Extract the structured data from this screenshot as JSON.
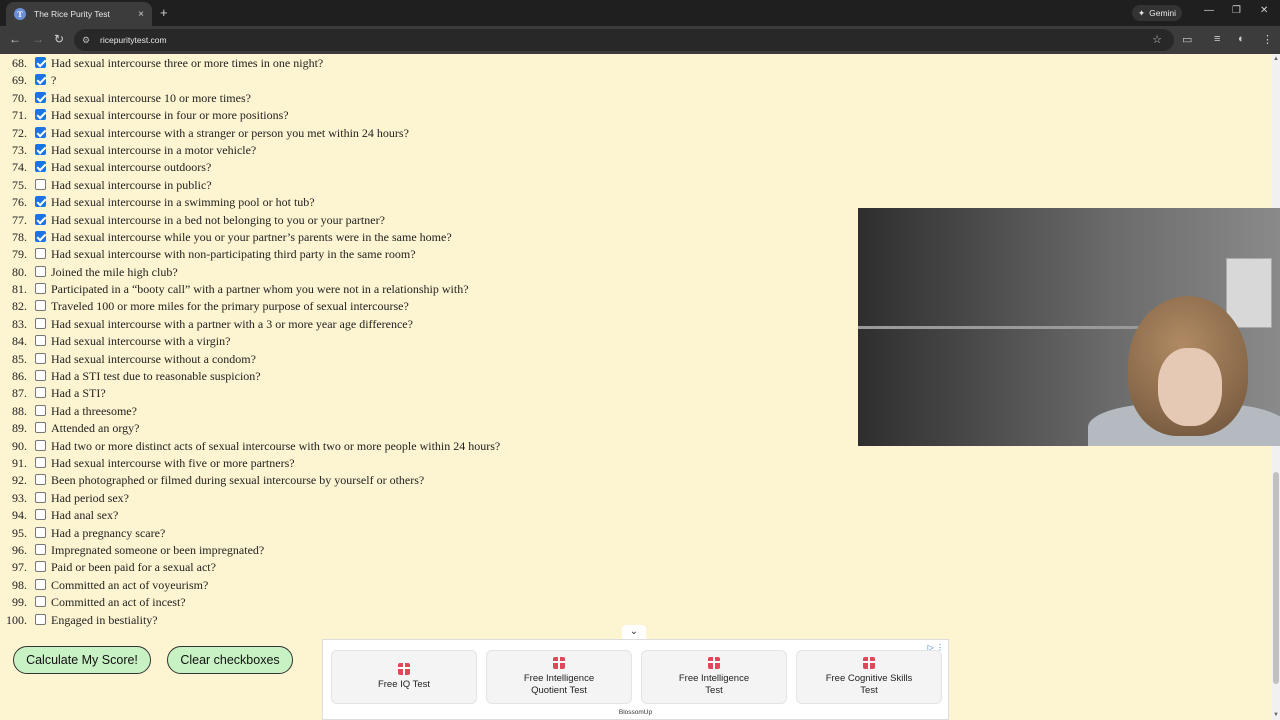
{
  "browser": {
    "tab_title": "The Rice Purity Test",
    "tab_favicon": "T",
    "new_tab": "+",
    "tab_close": "×",
    "gemini_label": "Gemini",
    "url": "ricepuritytest.com",
    "win_controls": {
      "minimize": "—",
      "restore": "❐",
      "close": "✕"
    },
    "nav": {
      "back": "←",
      "forward": "→",
      "reload": "↻"
    }
  },
  "questions": [
    {
      "num": "68.",
      "text": "Had sexual intercourse three or more times in one night?",
      "checked": true
    },
    {
      "num": "69.",
      "text": "?",
      "checked": true
    },
    {
      "num": "70.",
      "text": "Had sexual intercourse 10 or more times?",
      "checked": true
    },
    {
      "num": "71.",
      "text": "Had sexual intercourse in four or more positions?",
      "checked": true
    },
    {
      "num": "72.",
      "text": "Had sexual intercourse with a stranger or person you met within 24 hours?",
      "checked": true
    },
    {
      "num": "73.",
      "text": "Had sexual intercourse in a motor vehicle?",
      "checked": true
    },
    {
      "num": "74.",
      "text": "Had sexual intercourse outdoors?",
      "checked": true
    },
    {
      "num": "75.",
      "text": "Had sexual intercourse in public?",
      "checked": false
    },
    {
      "num": "76.",
      "text": "Had sexual intercourse in a swimming pool or hot tub?",
      "checked": true
    },
    {
      "num": "77.",
      "text": "Had sexual intercourse in a bed not belonging to you or your partner?",
      "checked": true
    },
    {
      "num": "78.",
      "text": "Had sexual intercourse while you or your partner’s parents were in the same home?",
      "checked": true
    },
    {
      "num": "79.",
      "text": "Had sexual intercourse with non-participating third party in the same room?",
      "checked": false
    },
    {
      "num": "80.",
      "text": "Joined the mile high club?",
      "checked": false
    },
    {
      "num": "81.",
      "text": "Participated in a “booty call” with a partner whom you were not in a relationship with?",
      "checked": false
    },
    {
      "num": "82.",
      "text": "Traveled 100 or more miles for the primary purpose of sexual intercourse?",
      "checked": false
    },
    {
      "num": "83.",
      "text": "Had sexual intercourse with a partner with a 3 or more year age difference?",
      "checked": false
    },
    {
      "num": "84.",
      "text": "Had sexual intercourse with a virgin?",
      "checked": false
    },
    {
      "num": "85.",
      "text": "Had sexual intercourse without a condom?",
      "checked": false
    },
    {
      "num": "86.",
      "text": "Had a STI test due to reasonable suspicion?",
      "checked": false
    },
    {
      "num": "87.",
      "text": "Had a STI?",
      "checked": false
    },
    {
      "num": "88.",
      "text": "Had a threesome?",
      "checked": false
    },
    {
      "num": "89.",
      "text": "Attended an orgy?",
      "checked": false
    },
    {
      "num": "90.",
      "text": "Had two or more distinct acts of sexual intercourse with two or more people within 24 hours?",
      "checked": false
    },
    {
      "num": "91.",
      "text": "Had sexual intercourse with five or more partners?",
      "checked": false
    },
    {
      "num": "92.",
      "text": "Been photographed or filmed during sexual intercourse by yourself or others?",
      "checked": false
    },
    {
      "num": "93.",
      "text": "Had period sex?",
      "checked": false
    },
    {
      "num": "94.",
      "text": "Had anal sex?",
      "checked": false
    },
    {
      "num": "95.",
      "text": "Had a pregnancy scare?",
      "checked": false
    },
    {
      "num": "96.",
      "text": "Impregnated someone or been impregnated?",
      "checked": false
    },
    {
      "num": "97.",
      "text": "Paid or been paid for a sexual act?",
      "checked": false
    },
    {
      "num": "98.",
      "text": "Committed an act of voyeurism?",
      "checked": false
    },
    {
      "num": "99.",
      "text": "Committed an act of incest?",
      "checked": false
    },
    {
      "num": "100.",
      "text": "Engaged in bestiality?",
      "checked": false
    }
  ],
  "buttons": {
    "calculate": "Calculate My Score!",
    "clear": "Clear checkboxes"
  },
  "ad": {
    "toggle": "⌄",
    "cards": [
      "Free IQ Test",
      "Free Intelligence Quotient Test",
      "Free Intelligence Test",
      "Free Cognitive Skills Test"
    ],
    "brand": "BlossomUp",
    "choices": "▷ ⋮"
  },
  "colors": {
    "page_bg": "#fdf4d1",
    "checkbox_checked": "#1a73e8",
    "button_bg": "#c8f2c3"
  }
}
